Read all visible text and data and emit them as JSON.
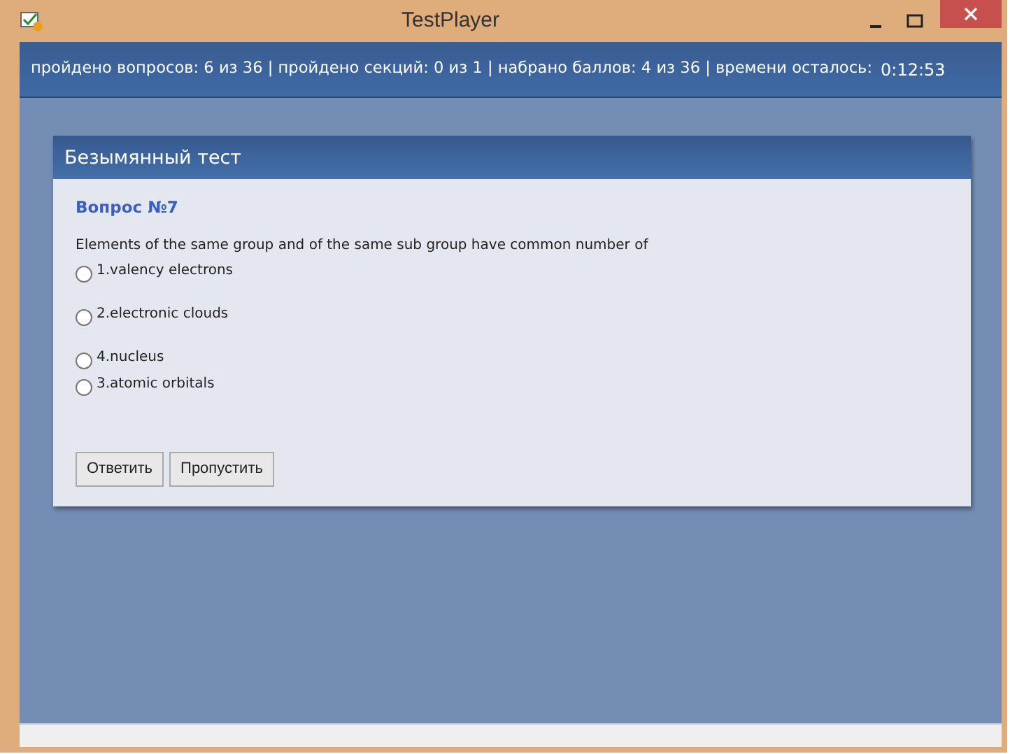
{
  "window": {
    "title": "TestPlayer"
  },
  "status": {
    "text": "пройдено вопросов: 6 из 36 | пройдено секций: 0 из 1 | набрано баллов: 4 из 36 | времени осталось:",
    "timer": "0:12:53"
  },
  "panel": {
    "title": "Безымянный тест",
    "question_number": "Вопрос №7",
    "question": "Elements of the same group and of the same sub group have common number of",
    "options": [
      {
        "label": "1.valency electrons",
        "selected": false
      },
      {
        "label": "2.electronic clouds",
        "selected": false
      },
      {
        "label": "4.nucleus",
        "selected": false
      },
      {
        "label": "3.atomic orbitals",
        "selected": false
      }
    ],
    "buttons": [
      "Ответить",
      "Пропустить"
    ]
  }
}
